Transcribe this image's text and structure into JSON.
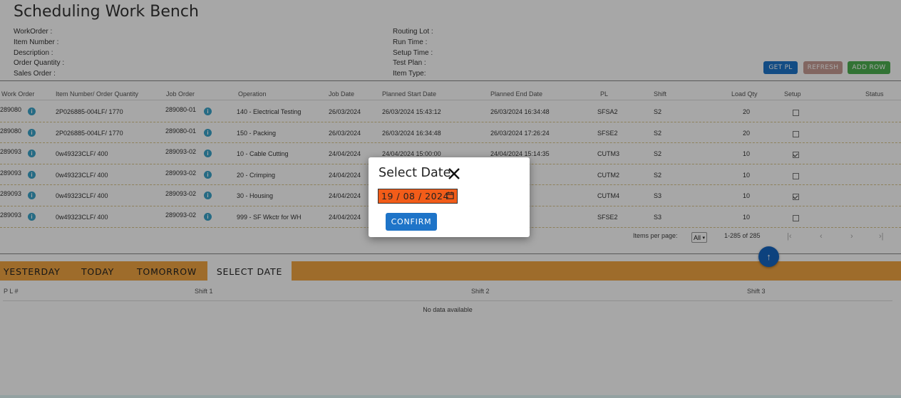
{
  "page": {
    "title": "Scheduling Work Bench"
  },
  "info_left": [
    "WorkOrder :",
    "Item Number :",
    "Description :",
    "Order Quantity :",
    "Sales Order :"
  ],
  "info_right": [
    "Routing Lot :",
    "Run Time :",
    "Setup Time :",
    "Test Plan :",
    "Item Type:"
  ],
  "buttons": {
    "get_pl": "GET PL",
    "refresh": "REFRESH",
    "add_row": "ADD ROW"
  },
  "colors": {
    "get_pl": "#1e74c8",
    "refresh": "#c59c94",
    "add_row": "#4caf50",
    "tab_bar": "#f0a442",
    "date_input_bg": "#f25c19"
  },
  "table": {
    "headers": [
      "Work Order",
      "Item Number/ Order Quantity",
      "Job Order",
      "Operation",
      "Job Date",
      "Planned Start Date",
      "Planned End Date",
      "PL",
      "Shift",
      "Load Qty",
      "Setup",
      "Status"
    ],
    "rows": [
      {
        "work_order": "289080",
        "item": "2P026885-004LF/ 1770",
        "job_order": "289080-01",
        "operation": "140 - Electrical Testing",
        "job_date": "26/03/2024",
        "start": "26/03/2024 15:43:12",
        "end": "26/03/2024 16:34:48",
        "pl": "SFSA2",
        "shift": "S2",
        "load_qty": "20",
        "setup": false
      },
      {
        "work_order": "289080",
        "item": "2P026885-004LF/ 1770",
        "job_order": "289080-01",
        "operation": "150 - Packing",
        "job_date": "26/03/2024",
        "start": "26/03/2024 16:34:48",
        "end": "26/03/2024 17:26:24",
        "pl": "SFSE2",
        "shift": "S2",
        "load_qty": "20",
        "setup": false
      },
      {
        "work_order": "289093",
        "item": "0w49323CLF/ 400",
        "job_order": "289093-02",
        "operation": "10 - Cable Cutting",
        "job_date": "24/04/2024",
        "start": "24/04/2024 15:00:00",
        "end": "24/04/2024 15:14:35",
        "pl": "CUTM3",
        "shift": "S2",
        "load_qty": "10",
        "setup": true
      },
      {
        "work_order": "289093",
        "item": "0w49323CLF/ 400",
        "job_order": "289093-02",
        "operation": "20 - Crimping",
        "job_date": "24/04/2024",
        "start": "",
        "end": "5:22:23",
        "pl": "CUTM2",
        "shift": "S2",
        "load_qty": "10",
        "setup": false
      },
      {
        "work_order": "289093",
        "item": "0w49323CLF/ 400",
        "job_order": "289093-02",
        "operation": "30 - Housing",
        "job_date": "24/04/2024",
        "start": "",
        "end": "3:21:36",
        "pl": "CUTM4",
        "shift": "S3",
        "load_qty": "10",
        "setup": true
      },
      {
        "work_order": "289093",
        "item": "0w49323CLF/ 400",
        "job_order": "289093-02",
        "operation": "999 - SF Wkctr for WH",
        "job_date": "24/04/2024",
        "start": "",
        "end": "3:56:24",
        "pl": "SFSE2",
        "shift": "S3",
        "load_qty": "10",
        "setup": false
      }
    ]
  },
  "pagination": {
    "items_per_page_label": "Items per page:",
    "items_per_page_value": "All",
    "range": "1-285 of 285"
  },
  "tabs": [
    "YESTERDAY",
    "TODAY",
    "TOMORROW",
    "SELECT DATE"
  ],
  "pl_table": {
    "headers": [
      "P L #",
      "Shift 1",
      "Shift 2",
      "Shift 3"
    ],
    "empty_text": "No data available"
  },
  "dialog": {
    "title": "Select Date",
    "date_value": "19 / 08 / 2024",
    "confirm_label": "CONFIRM"
  }
}
